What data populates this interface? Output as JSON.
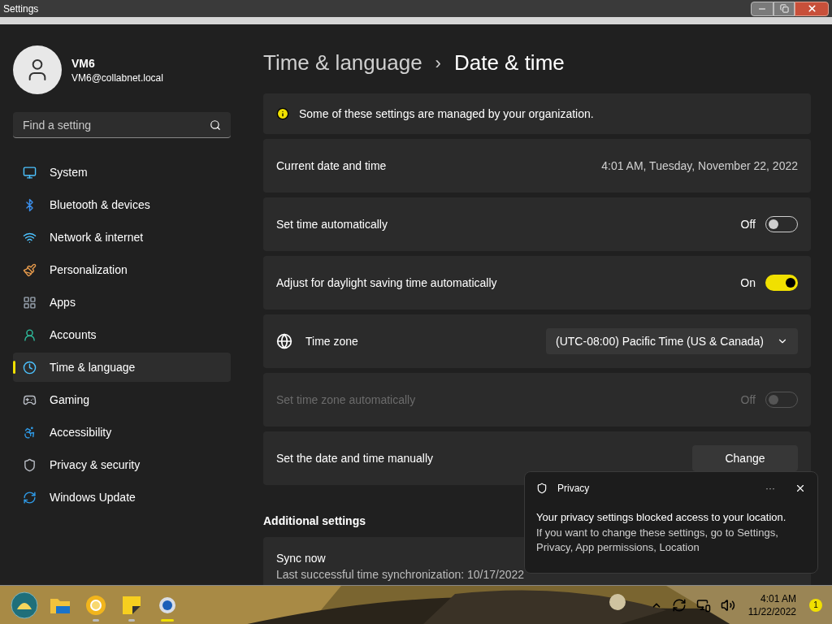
{
  "window": {
    "title": "Settings"
  },
  "profile": {
    "name": "VM6",
    "email": "VM6@collabnet.local"
  },
  "search": {
    "placeholder": "Find a setting"
  },
  "sidebar": {
    "items": [
      {
        "label": "System",
        "selected": false
      },
      {
        "label": "Bluetooth & devices",
        "selected": false
      },
      {
        "label": "Network & internet",
        "selected": false
      },
      {
        "label": "Personalization",
        "selected": false
      },
      {
        "label": "Apps",
        "selected": false
      },
      {
        "label": "Accounts",
        "selected": false
      },
      {
        "label": "Time & language",
        "selected": true
      },
      {
        "label": "Gaming",
        "selected": false
      },
      {
        "label": "Accessibility",
        "selected": false
      },
      {
        "label": "Privacy & security",
        "selected": false
      },
      {
        "label": "Windows Update",
        "selected": false
      }
    ]
  },
  "breadcrumb": {
    "parent": "Time & language",
    "separator": "›",
    "current": "Date & time"
  },
  "cards": [
    {
      "kind": "info",
      "label": "Some of these settings are managed by your organization."
    },
    {
      "kind": "value",
      "label": "Current date and time",
      "value": "4:01 AM, Tuesday, November 22, 2022"
    },
    {
      "kind": "toggle",
      "label": "Set time automatically",
      "state": "Off",
      "on": false,
      "disabled": false
    },
    {
      "kind": "toggle",
      "label": "Adjust for daylight saving time automatically",
      "state": "On",
      "on": true,
      "disabled": false
    },
    {
      "kind": "dropdown",
      "label": "Time zone",
      "value": "(UTC-08:00) Pacific Time (US & Canada)"
    },
    {
      "kind": "toggle",
      "label": "Set time zone automatically",
      "state": "Off",
      "on": false,
      "disabled": true
    },
    {
      "kind": "button",
      "label": "Set the date and time manually",
      "button": "Change"
    }
  ],
  "additional": {
    "heading": "Additional settings",
    "sync_title": "Sync now",
    "sync_detail": "Last successful time synchronization: 10/17/2022"
  },
  "toast": {
    "app": "Privacy",
    "more": "···",
    "title": "Your privacy settings blocked access to your location.",
    "body": "If you want to change these settings, go to Settings, Privacy, App permissions, Location"
  },
  "taskbar": {
    "apps": [
      {
        "active": false
      },
      {
        "active": false
      },
      {
        "active": true
      },
      {
        "active": true
      },
      {
        "active": true
      }
    ],
    "time": "4:01 AM",
    "date": "11/22/2022",
    "badge": "1"
  }
}
